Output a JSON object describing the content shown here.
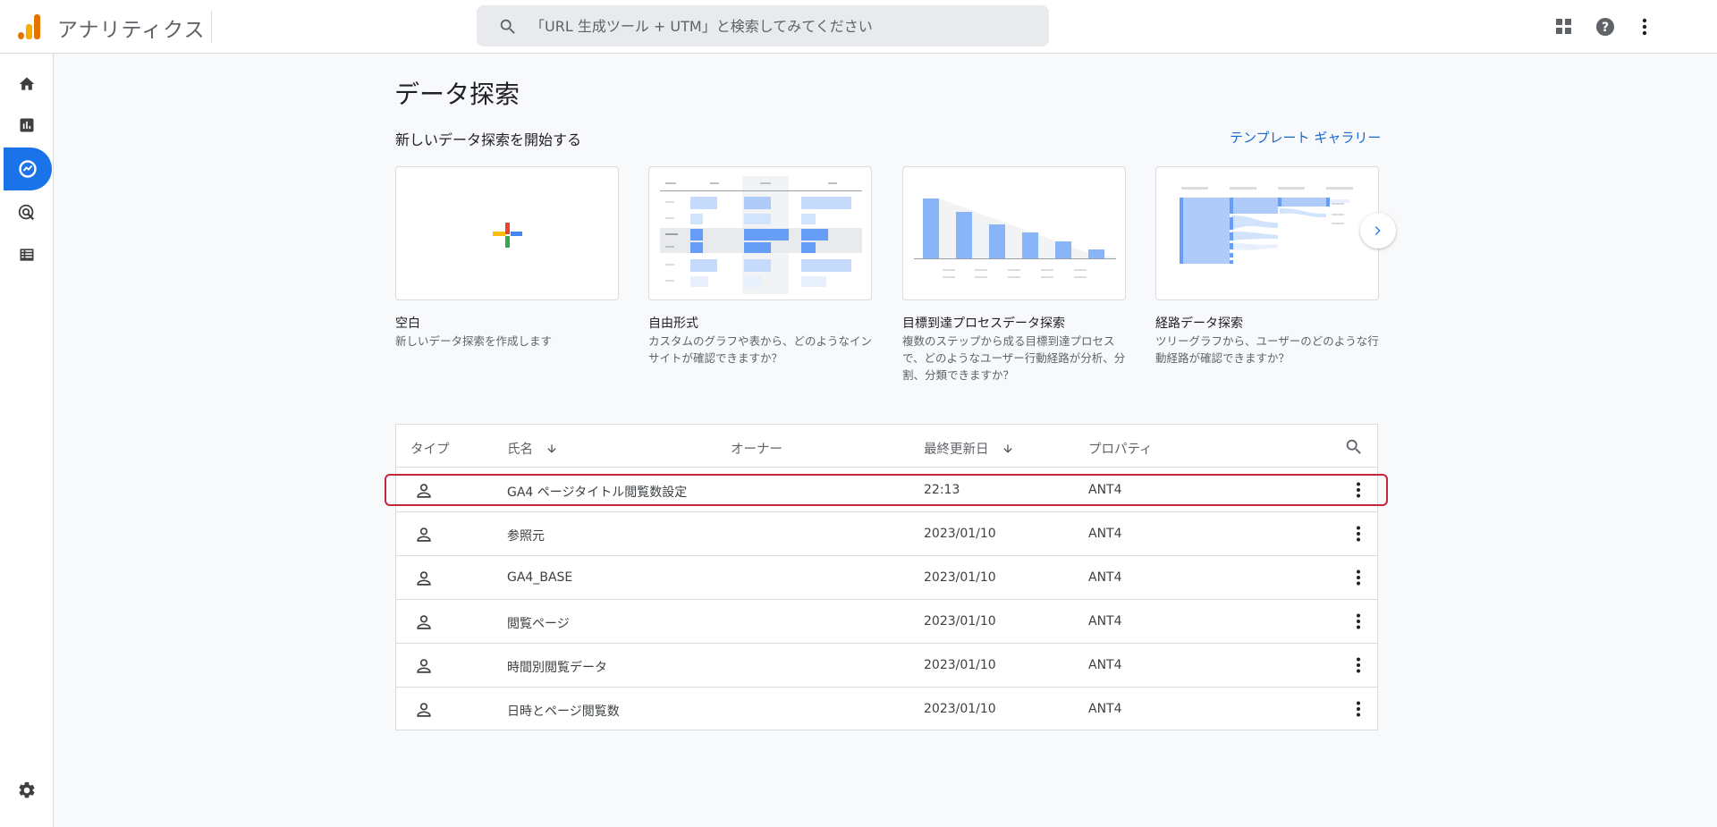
{
  "app": {
    "title": "アナリティクス"
  },
  "search": {
    "placeholder": "「URL 生成ツール + UTM」と検索してみてください"
  },
  "page": {
    "title": "データ探索",
    "section_title": "新しいデータ探索を開始する",
    "gallery_link": "テンプレート ギャラリー"
  },
  "templates": [
    {
      "name": "空白",
      "description": "新しいデータ探索を作成します"
    },
    {
      "name": "自由形式",
      "description": "カスタムのグラフや表から、どのようなインサイトが確認できますか？"
    },
    {
      "name": "目標到達プロセスデータ探索",
      "description": "複数のステップから成る目標到達プロセスで、どのようなユーザー行動経路が分析、分割、分類できますか？"
    },
    {
      "name": "経路データ探索",
      "description": "ツリーグラフから、ユーザーのどのような行動経路が確認できますか？"
    }
  ],
  "table": {
    "headers": {
      "type": "タイプ",
      "name": "氏名",
      "owner": "オーナー",
      "modified": "最終更新日",
      "property": "プロパティ"
    },
    "rows": [
      {
        "name": "GA4 ページタイトル閲覧数設定",
        "modified": "22:13",
        "property": "ANT4"
      },
      {
        "name": "参照元",
        "modified": "2023/01/10",
        "property": "ANT4"
      },
      {
        "name": "GA4_BASE",
        "modified": "2023/01/10",
        "property": "ANT4"
      },
      {
        "name": "閲覧ページ",
        "modified": "2023/01/10",
        "property": "ANT4"
      },
      {
        "name": "時間別閲覧データ",
        "modified": "2023/01/10",
        "property": "ANT4"
      },
      {
        "name": "日時とページ閲覧数",
        "modified": "2023/01/10",
        "property": "ANT4"
      }
    ]
  },
  "icons": {
    "logo": "analytics-logo-icon",
    "search": "search-icon",
    "apps": "apps-grid-icon",
    "help": "help-icon",
    "more": "more-vert-icon",
    "nav": [
      "home-icon",
      "reports-icon",
      "explore-icon",
      "advertising-icon",
      "configure-icon",
      "settings-icon"
    ]
  },
  "colors": {
    "accent": "#1a73e8",
    "link": "#1967d2",
    "highlight": "#c5283d"
  }
}
